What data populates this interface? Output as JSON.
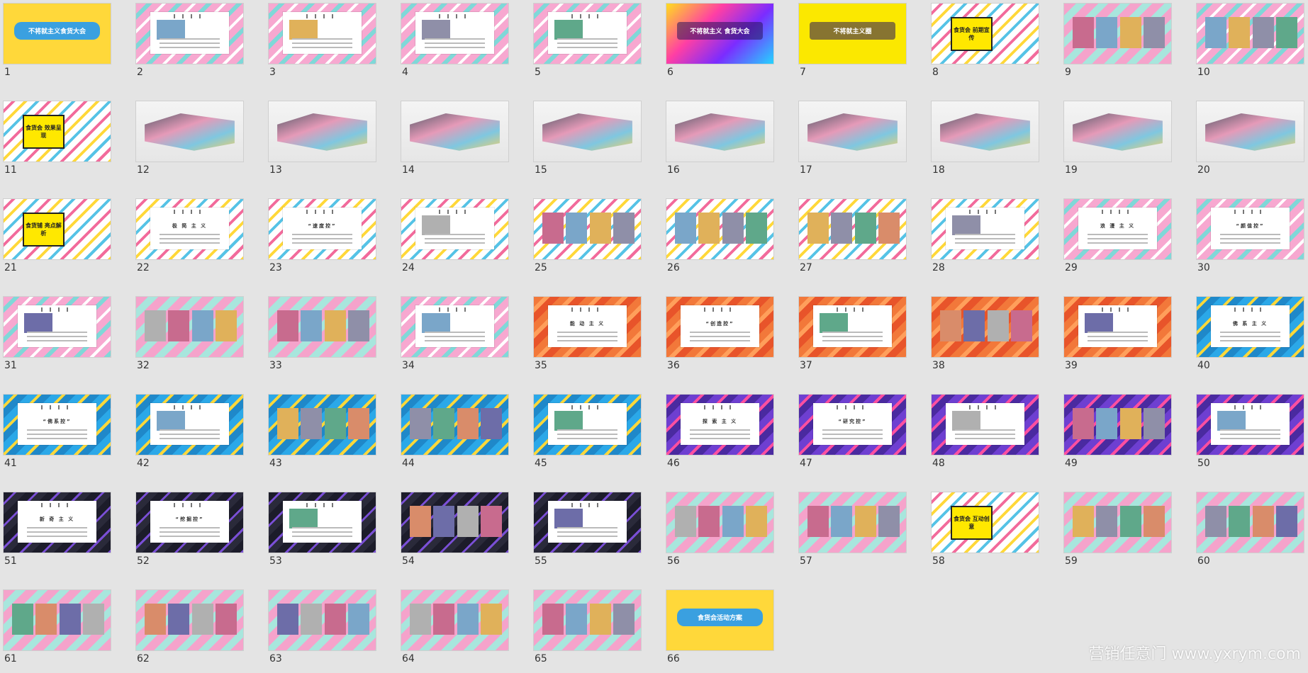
{
  "watermark": "营销任意门 www.yxrym.com",
  "slides": [
    {
      "n": "1",
      "theme": "yellow",
      "kind": "banner",
      "text": "不将就主义食货大会"
    },
    {
      "n": "2",
      "theme": "pink",
      "kind": "card",
      "text": ""
    },
    {
      "n": "3",
      "theme": "pink",
      "kind": "card",
      "text": ""
    },
    {
      "n": "4",
      "theme": "pink",
      "kind": "card",
      "text": ""
    },
    {
      "n": "5",
      "theme": "pink",
      "kind": "card",
      "text": ""
    },
    {
      "n": "6",
      "theme": "neon",
      "kind": "poster",
      "text": "不将就主义 食货大会"
    },
    {
      "n": "7",
      "theme": "yellow2",
      "kind": "poster",
      "text": "不将就主义圈"
    },
    {
      "n": "8",
      "theme": "stripe",
      "kind": "section",
      "text": "食货会 前期宣传"
    },
    {
      "n": "9",
      "theme": "pinkmint",
      "kind": "photos",
      "text": ""
    },
    {
      "n": "10",
      "theme": "pink",
      "kind": "photos",
      "text": ""
    },
    {
      "n": "11",
      "theme": "stripe",
      "kind": "section",
      "text": "食货会 效果呈现"
    },
    {
      "n": "12",
      "theme": "render",
      "kind": "render",
      "text": ""
    },
    {
      "n": "13",
      "theme": "render",
      "kind": "render",
      "text": ""
    },
    {
      "n": "14",
      "theme": "render",
      "kind": "render",
      "text": ""
    },
    {
      "n": "15",
      "theme": "render",
      "kind": "render",
      "text": ""
    },
    {
      "n": "16",
      "theme": "render",
      "kind": "render",
      "text": ""
    },
    {
      "n": "17",
      "theme": "render",
      "kind": "render",
      "text": ""
    },
    {
      "n": "18",
      "theme": "render",
      "kind": "render",
      "text": ""
    },
    {
      "n": "19",
      "theme": "render",
      "kind": "render",
      "text": ""
    },
    {
      "n": "20",
      "theme": "render",
      "kind": "render",
      "text": ""
    },
    {
      "n": "21",
      "theme": "stripe",
      "kind": "section",
      "text": "食货铺 亮点解析"
    },
    {
      "n": "22",
      "theme": "stripe",
      "kind": "card",
      "text": "极 简 主 义"
    },
    {
      "n": "23",
      "theme": "stripe",
      "kind": "card",
      "text": "“速度控”"
    },
    {
      "n": "24",
      "theme": "stripe",
      "kind": "card",
      "text": ""
    },
    {
      "n": "25",
      "theme": "stripe",
      "kind": "photos",
      "text": ""
    },
    {
      "n": "26",
      "theme": "stripe",
      "kind": "photos",
      "text": ""
    },
    {
      "n": "27",
      "theme": "stripe",
      "kind": "photos",
      "text": ""
    },
    {
      "n": "28",
      "theme": "stripe",
      "kind": "card",
      "text": ""
    },
    {
      "n": "29",
      "theme": "pink",
      "kind": "card",
      "text": "浪 漫 主 义"
    },
    {
      "n": "30",
      "theme": "pink",
      "kind": "card",
      "text": "“颜值控”"
    },
    {
      "n": "31",
      "theme": "pink",
      "kind": "card",
      "text": ""
    },
    {
      "n": "32",
      "theme": "pinkmint",
      "kind": "photos",
      "text": ""
    },
    {
      "n": "33",
      "theme": "pinkmint",
      "kind": "photos",
      "text": ""
    },
    {
      "n": "34",
      "theme": "pink",
      "kind": "card",
      "text": ""
    },
    {
      "n": "35",
      "theme": "orange",
      "kind": "card",
      "text": "能 动 主 义"
    },
    {
      "n": "36",
      "theme": "orange",
      "kind": "card",
      "text": "“创造控”"
    },
    {
      "n": "37",
      "theme": "orange",
      "kind": "card",
      "text": ""
    },
    {
      "n": "38",
      "theme": "orange",
      "kind": "photos",
      "text": ""
    },
    {
      "n": "39",
      "theme": "orange",
      "kind": "card",
      "text": ""
    },
    {
      "n": "40",
      "theme": "blue",
      "kind": "card",
      "text": "佛 系 主 义"
    },
    {
      "n": "41",
      "theme": "blue",
      "kind": "card",
      "text": "“佛系控”"
    },
    {
      "n": "42",
      "theme": "blue",
      "kind": "card",
      "text": ""
    },
    {
      "n": "43",
      "theme": "blue",
      "kind": "photos",
      "text": ""
    },
    {
      "n": "44",
      "theme": "blue",
      "kind": "photos",
      "text": ""
    },
    {
      "n": "45",
      "theme": "blue",
      "kind": "card",
      "text": ""
    },
    {
      "n": "46",
      "theme": "violet",
      "kind": "card",
      "text": "探 索 主 义"
    },
    {
      "n": "47",
      "theme": "violet",
      "kind": "card",
      "text": "“研究控”"
    },
    {
      "n": "48",
      "theme": "violet",
      "kind": "card",
      "text": ""
    },
    {
      "n": "49",
      "theme": "violet",
      "kind": "photos",
      "text": ""
    },
    {
      "n": "50",
      "theme": "violet",
      "kind": "card",
      "text": ""
    },
    {
      "n": "51",
      "theme": "dark",
      "kind": "card",
      "text": "新 奇 主 义"
    },
    {
      "n": "52",
      "theme": "dark",
      "kind": "card",
      "text": "“挖掘控”"
    },
    {
      "n": "53",
      "theme": "dark",
      "kind": "card",
      "text": ""
    },
    {
      "n": "54",
      "theme": "dark",
      "kind": "photos",
      "text": ""
    },
    {
      "n": "55",
      "theme": "dark",
      "kind": "card",
      "text": ""
    },
    {
      "n": "56",
      "theme": "pinkmint",
      "kind": "photos",
      "text": ""
    },
    {
      "n": "57",
      "theme": "pinkmint",
      "kind": "photos",
      "text": ""
    },
    {
      "n": "58",
      "theme": "stripe",
      "kind": "section",
      "text": "食货会 互动创意"
    },
    {
      "n": "59",
      "theme": "pinkmint",
      "kind": "photos",
      "text": ""
    },
    {
      "n": "60",
      "theme": "pinkmint",
      "kind": "photos",
      "text": ""
    },
    {
      "n": "61",
      "theme": "pinkmint",
      "kind": "photos",
      "text": ""
    },
    {
      "n": "62",
      "theme": "pinkmint",
      "kind": "photos",
      "text": ""
    },
    {
      "n": "63",
      "theme": "pinkmint",
      "kind": "photos",
      "text": ""
    },
    {
      "n": "64",
      "theme": "pinkmint",
      "kind": "photos",
      "text": ""
    },
    {
      "n": "65",
      "theme": "pinkmint",
      "kind": "photos",
      "text": ""
    },
    {
      "n": "66",
      "theme": "yellow",
      "kind": "banner",
      "text": "食货会活动方案"
    }
  ]
}
